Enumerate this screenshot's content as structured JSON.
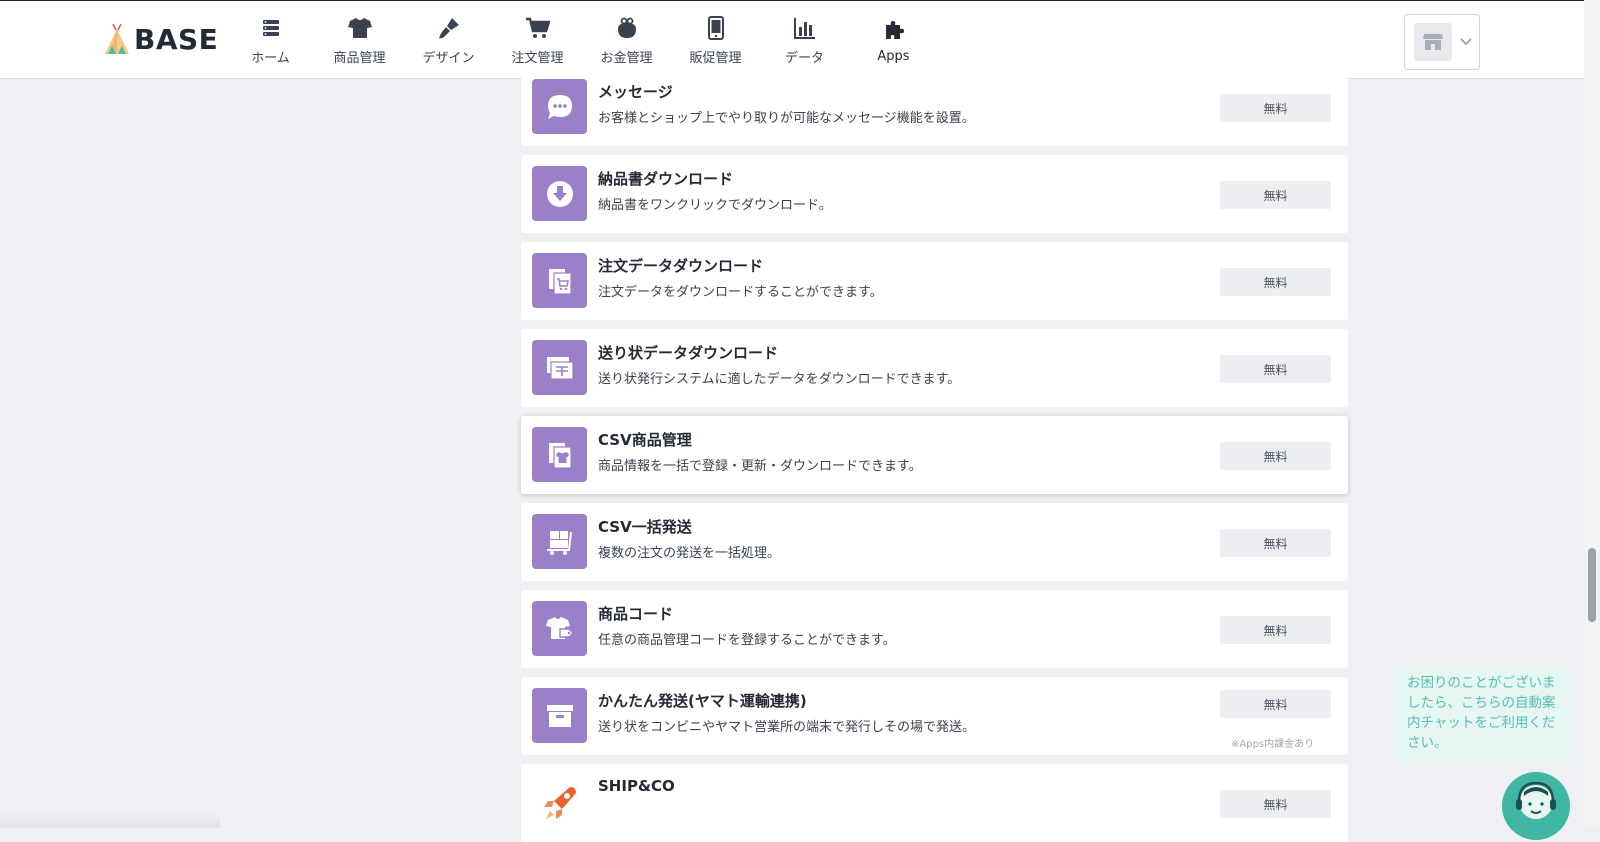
{
  "header": {
    "logo_text": "BASE",
    "nav": [
      {
        "label": "ホーム",
        "icon": "home-list-icon"
      },
      {
        "label": "商品管理",
        "icon": "tshirt-icon"
      },
      {
        "label": "デザイン",
        "icon": "brush-icon"
      },
      {
        "label": "注文管理",
        "icon": "cart-icon"
      },
      {
        "label": "お金管理",
        "icon": "wallet-icon"
      },
      {
        "label": "販促管理",
        "icon": "mobile-icon"
      },
      {
        "label": "データ",
        "icon": "bar-chart-icon"
      },
      {
        "label": "Apps",
        "icon": "puzzle-icon"
      }
    ]
  },
  "apps": [
    {
      "title": "メッセージ",
      "desc": "お客様とショップ上でやり取りが可能なメッセージ機能を設置。",
      "price": "無料",
      "icon": "message-icon"
    },
    {
      "title": "納品書ダウンロード",
      "desc": "納品書をワンクリックでダウンロード。",
      "price": "無料",
      "icon": "download-icon"
    },
    {
      "title": "注文データダウンロード",
      "desc": "注文データをダウンロードすることができます。",
      "price": "無料",
      "icon": "order-data-icon"
    },
    {
      "title": "送り状データダウンロード",
      "desc": "送り状発行システムに適したデータをダウンロードできます。",
      "price": "無料",
      "icon": "invoice-data-icon"
    },
    {
      "title": "CSV商品管理",
      "desc": "商品情報を一括で登録・更新・ダウンロードできます。",
      "price": "無料",
      "icon": "csv-product-icon"
    },
    {
      "title": "CSV一括発送",
      "desc": "複数の注文の発送を一括処理。",
      "price": "無料",
      "icon": "cart-boxes-icon"
    },
    {
      "title": "商品コード",
      "desc": "任意の商品管理コードを登録することができます。",
      "price": "無料",
      "icon": "product-code-icon"
    },
    {
      "title": "かんたん発送(ヤマト運輸連携)",
      "desc": "送り状をコンビニやヤマト営業所の端末で発行しその場で発送。",
      "price": "無料",
      "note": "※Apps内課金あり",
      "icon": "box-icon"
    },
    {
      "title": "SHIP&CO",
      "desc": "",
      "price": "無料",
      "icon": "rocket-icon"
    }
  ],
  "chat": {
    "message": "お困りのことがございましたら、こちらの自動案内チャットをご利用ください。"
  },
  "colors": {
    "app_icon_bg": "#9b7fc8",
    "chat_bg": "#e5f6f3",
    "chat_text": "#56bfb3",
    "chat_avatar": "#3fb5a4"
  }
}
